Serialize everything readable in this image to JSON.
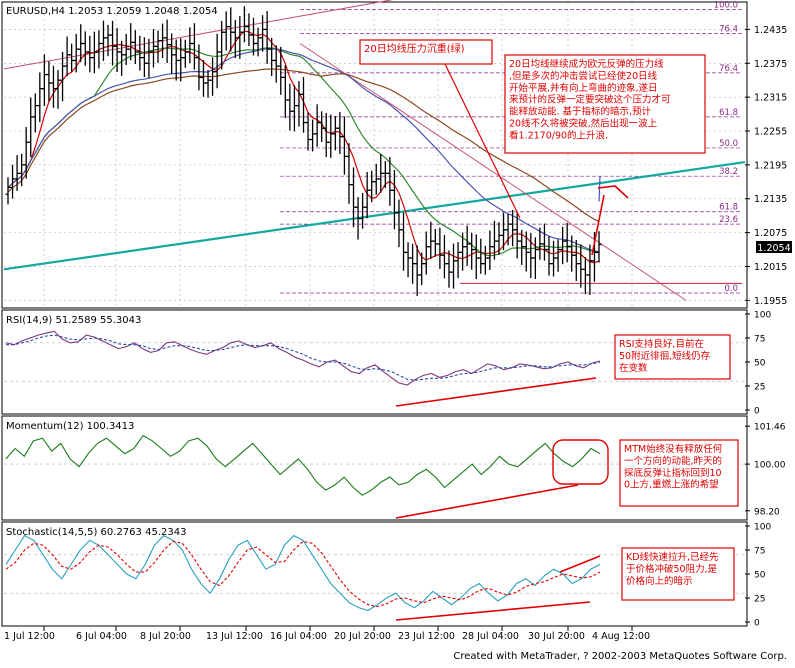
{
  "meta": {
    "footer": "Created with MetaTrader, ? 2002-2003 MetaQuotes Software Corp."
  },
  "colors": {
    "background": "#ffffff",
    "frame": "#000000",
    "grid": "#b4b4b4",
    "candle": "#000000",
    "ma_red": "#d40000",
    "ma_green": "#2f8a2f",
    "ma_blue": "#4a55b0",
    "ma_brown": "#8b4a20",
    "trendline_teal": "#13a8a0",
    "trendline_pink": "#c8506a",
    "fib": "#8a2a8a",
    "annotation": "#e00000",
    "rsi_main": "#7b3b7b",
    "rsi_signal": "#2a4aa8",
    "momentum": "#1a7a1a",
    "stoch_main": "#2aa0c0",
    "stoch_signal": "#e00000",
    "price_label_bg": "#000000"
  },
  "chart_data": [
    {
      "type": "candlestick",
      "panel": "price",
      "header": "EURUSD,H4  1.2053  1.2059  1.2048  1.2054",
      "current_price_label": "1.2054",
      "current_price": 1.2054,
      "y_ticks": [
        "1.2435",
        "1.2375",
        "1.2315",
        "1.2255",
        "1.2195",
        "1.2135",
        "1.2075",
        "1.2015",
        "1.1955"
      ],
      "ylim": [
        1.1945,
        1.248
      ],
      "fib_levels": [
        {
          "label": "100.0",
          "price": 1.247
        },
        {
          "label": "76.4",
          "price": 1.2428
        },
        {
          "label": "76.4",
          "price": 1.2358
        },
        {
          "label": "61.8",
          "price": 1.228
        },
        {
          "label": "50.0",
          "price": 1.2225
        },
        {
          "label": "38.2",
          "price": 1.2175
        },
        {
          "label": "61.8",
          "price": 1.2112
        },
        {
          "label": "23.6",
          "price": 1.209
        },
        {
          "label": "0.0",
          "price": 1.1968
        }
      ],
      "x_labels": [
        "1 Jul 12:00",
        "6 Jul 04:00",
        "8 Jul 20:00",
        "13 Jul 12:00",
        "16 Jul 04:00",
        "20 Jul 20:00",
        "23 Jul 12:00",
        "28 Jul 04:00",
        "30 Jul 20:00",
        "4 Aug 12:00"
      ],
      "closes": [
        1.2155,
        1.217,
        1.218,
        1.2195,
        1.2235,
        1.228,
        1.23,
        1.233,
        1.2355,
        1.234,
        1.233,
        1.2345,
        1.237,
        1.239,
        1.238,
        1.24,
        1.241,
        1.2395,
        1.2385,
        1.2395,
        1.241,
        1.242,
        1.2425,
        1.2405,
        1.2395,
        1.239,
        1.24,
        1.2412,
        1.2395,
        1.2385,
        1.2375,
        1.2395,
        1.2405,
        1.2415,
        1.242,
        1.2408,
        1.239,
        1.238,
        1.2385,
        1.2395,
        1.241,
        1.2385,
        1.235,
        1.234,
        1.2345,
        1.236,
        1.2395,
        1.243,
        1.244,
        1.243,
        1.242,
        1.243,
        1.244,
        1.2425,
        1.241,
        1.242,
        1.2435,
        1.24,
        1.238,
        1.237,
        1.235,
        1.231,
        1.229,
        1.23,
        1.232,
        1.227,
        1.224,
        1.225,
        1.227,
        1.226,
        1.2235,
        1.225,
        1.226,
        1.2245,
        1.221,
        1.216,
        1.212,
        1.21,
        1.212,
        1.215,
        1.2165,
        1.217,
        1.218,
        1.218,
        1.215,
        1.211,
        1.208,
        1.204,
        1.203,
        1.202,
        1.2,
        1.202,
        1.205,
        1.206,
        1.2055,
        1.2035,
        1.202,
        1.2005,
        1.2025,
        1.204,
        1.205,
        1.2055,
        1.2045,
        1.203,
        1.202,
        1.203,
        1.205,
        1.206,
        1.207,
        1.208,
        1.209,
        1.208,
        1.206,
        1.205,
        1.204,
        1.203,
        1.2045,
        1.2055,
        1.2045,
        1.202,
        1.203,
        1.2045,
        1.206,
        1.205,
        1.2035,
        1.202,
        1.201,
        1.2,
        1.2025,
        1.204,
        1.2054
      ]
    },
    {
      "type": "line",
      "panel": "rsi",
      "header": "RSI(14,9)  51.2589  55.3043",
      "y_ticks": [
        "100",
        "75",
        "50",
        "25",
        "0"
      ],
      "ylim": [
        0,
        100
      ],
      "series": [
        {
          "name": "RSI(14)",
          "values": [
            70,
            68,
            72,
            75,
            78,
            80,
            82,
            74,
            70,
            71,
            78,
            76,
            72,
            68,
            64,
            66,
            70,
            64,
            60,
            62,
            70,
            71,
            67,
            63,
            60,
            58,
            62,
            65,
            70,
            72,
            68,
            65,
            67,
            70,
            64,
            60,
            55,
            52,
            48,
            45,
            50,
            52,
            46,
            40,
            38,
            44,
            47,
            40,
            34,
            28,
            26,
            32,
            36,
            38,
            34,
            36,
            40,
            42,
            38,
            43,
            48,
            46,
            42,
            44,
            48,
            47,
            45,
            43,
            44,
            48,
            50,
            46,
            44,
            49,
            51
          ]
        },
        {
          "name": "Signal(9)",
          "values": [
            68,
            68,
            70,
            72,
            75,
            77,
            78,
            76,
            74,
            73,
            74,
            75,
            74,
            72,
            69,
            68,
            68,
            67,
            64,
            63,
            65,
            67,
            67,
            66,
            64,
            62,
            62,
            63,
            65,
            67,
            68,
            67,
            67,
            67,
            66,
            64,
            61,
            58,
            54,
            51,
            50,
            50,
            49,
            46,
            43,
            42,
            43,
            42,
            40,
            36,
            32,
            31,
            32,
            33,
            33,
            34,
            36,
            38,
            38,
            40,
            42,
            44,
            44,
            44,
            45,
            46,
            46,
            45,
            45,
            46,
            47,
            47,
            47,
            48,
            50
          ]
        }
      ]
    },
    {
      "type": "line",
      "panel": "momentum",
      "header": "Momentum(12)  100.3413",
      "y_ticks": [
        "101.46",
        "100.00",
        "98.20"
      ],
      "ylim": [
        98.0,
        101.7
      ],
      "series": [
        {
          "name": "Momentum(12)",
          "values": [
            100.2,
            100.6,
            100.3,
            100.9,
            101.0,
            100.5,
            100.8,
            100.2,
            99.9,
            100.4,
            100.8,
            101.0,
            100.7,
            100.4,
            100.6,
            101.1,
            100.9,
            100.6,
            100.3,
            100.5,
            100.9,
            101.0,
            100.7,
            100.2,
            99.9,
            100.2,
            100.5,
            100.8,
            100.4,
            100.0,
            99.6,
            99.9,
            100.2,
            99.8,
            99.3,
            99.0,
            99.2,
            99.5,
            99.1,
            98.8,
            99.0,
            99.3,
            99.5,
            99.2,
            99.3,
            99.6,
            99.8,
            99.5,
            99.1,
            99.4,
            99.7,
            100.0,
            99.6,
            99.9,
            100.3,
            100.0,
            99.9,
            100.2,
            100.5,
            100.8,
            100.4,
            100.1,
            99.9,
            100.2,
            100.6,
            100.4
          ]
        }
      ]
    },
    {
      "type": "line",
      "panel": "stochastic",
      "header": "Stochastic(14,5,5)  60.2763  45.2343",
      "y_ticks": [
        "100",
        "75",
        "50",
        "25",
        "0"
      ],
      "ylim": [
        0,
        100
      ],
      "series": [
        {
          "name": "%K",
          "values": [
            60,
            75,
            90,
            85,
            70,
            55,
            45,
            60,
            75,
            85,
            80,
            70,
            60,
            50,
            45,
            60,
            80,
            90,
            85,
            75,
            55,
            40,
            30,
            45,
            65,
            80,
            85,
            70,
            55,
            60,
            80,
            90,
            85,
            70,
            55,
            40,
            30,
            20,
            15,
            12,
            18,
            25,
            30,
            20,
            15,
            22,
            32,
            25,
            18,
            25,
            35,
            40,
            30,
            22,
            28,
            40,
            45,
            38,
            48,
            55,
            50,
            40,
            45,
            55,
            60
          ]
        },
        {
          "name": "%D",
          "values": [
            55,
            62,
            75,
            82,
            80,
            70,
            58,
            55,
            62,
            73,
            80,
            78,
            70,
            60,
            52,
            52,
            62,
            75,
            84,
            82,
            70,
            55,
            42,
            38,
            48,
            62,
            75,
            78,
            70,
            62,
            63,
            75,
            84,
            82,
            72,
            58,
            44,
            32,
            24,
            18,
            16,
            19,
            24,
            25,
            22,
            20,
            24,
            27,
            25,
            23,
            27,
            33,
            35,
            31,
            28,
            31,
            37,
            40,
            42,
            46,
            50,
            48,
            46,
            47,
            52
          ]
        }
      ]
    }
  ],
  "annotations": {
    "ma_note": "20日均线压力沉重(绿)",
    "main_note": "20日均线继续成为欧元反弹的压力线,但是多次的冲击尝试已经使20日线开始平展,并有向上弯曲的迹象,遂日来预计的反弹一定要突破这个压力才可能释放动能. 基于指标的暗示,预计20线不久将被突破,然后出现一波上看1.2170/90的上升浪.",
    "rsi_note": "RSI支持良好,目前在50附近徘徊,短线仍存在变数",
    "momentum_note": "MTM始终没有释放任何一个方向的动能,昨天的探底反弹让指标回到100上方,重燃上涨的希望",
    "stoch_note": "KD线快速拉升,已经先于价格冲破50阻力,是价格向上的暗示"
  }
}
